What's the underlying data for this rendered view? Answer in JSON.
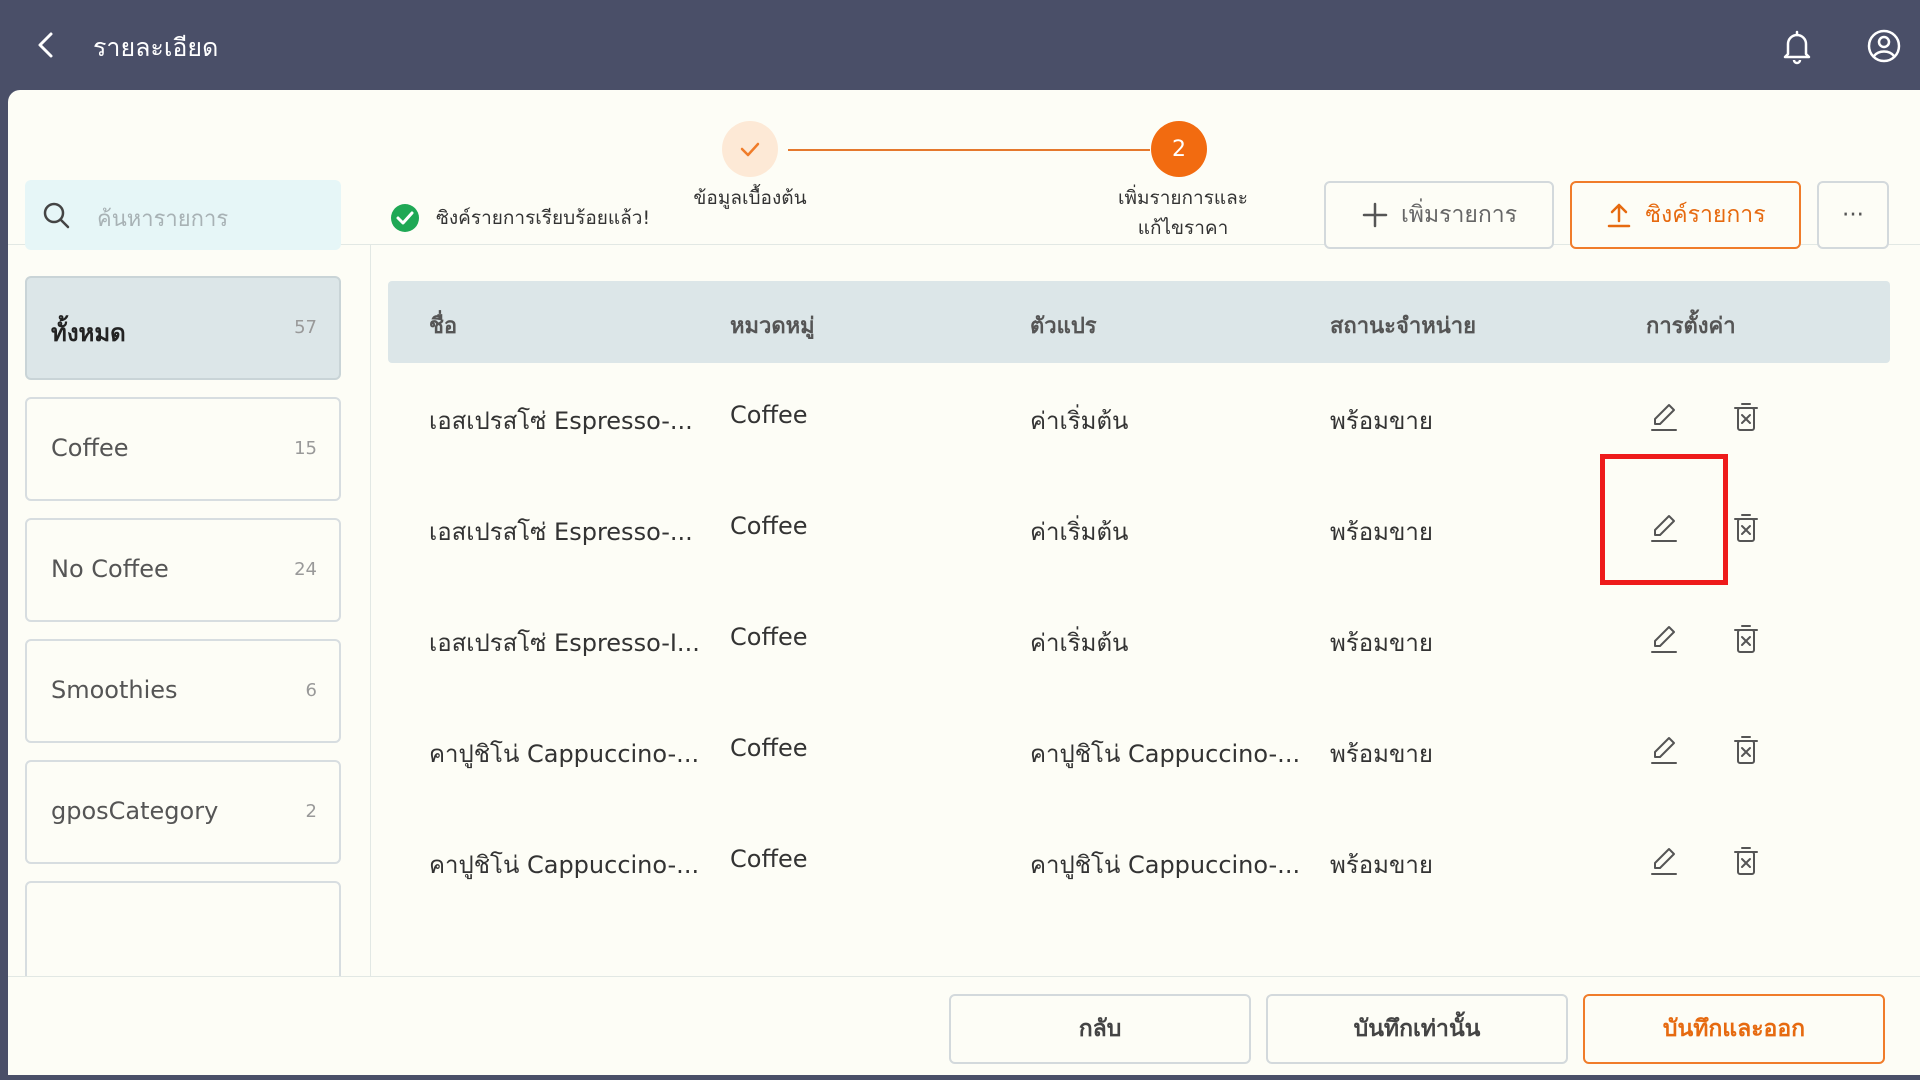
{
  "header": {
    "title": "รายละเอียด"
  },
  "stepper": {
    "step1": {
      "label": "ข้อมูลเบื้องต้น",
      "done": true
    },
    "step2": {
      "number": "2",
      "label": "เพิ่มรายการและ\nแก้ไขราคา",
      "active": true
    }
  },
  "sidebar": {
    "search_placeholder": "ค้นหารายการ",
    "categories": [
      {
        "name": "ทั้งหมด",
        "count": "57",
        "active": true
      },
      {
        "name": "Coffee",
        "count": "15"
      },
      {
        "name": "No Coffee",
        "count": "24"
      },
      {
        "name": "Smoothies",
        "count": "6"
      },
      {
        "name": "gposCategory",
        "count": "2"
      }
    ]
  },
  "status": {
    "message": "ซิงค์รายการเรียบร้อยแล้ว!"
  },
  "toolbar": {
    "add_label": "เพิ่มรายการ",
    "sync_label": "ซิงค์รายการ",
    "more_label": "···"
  },
  "table": {
    "headers": [
      "ชื่อ",
      "หมวดหมู่",
      "ตัวแปร",
      "สถานะจำหน่าย",
      "การตั้งค่า"
    ],
    "rows": [
      {
        "name": "เอสเปรสโซ่ Espresso-...",
        "category": "Coffee",
        "variant": "ค่าเริ่มต้น",
        "status": "พร้อมขาย"
      },
      {
        "name": "เอสเปรสโซ่ Espresso-...",
        "category": "Coffee",
        "variant": "ค่าเริ่มต้น",
        "status": "พร้อมขาย"
      },
      {
        "name": "เอสเปรสโซ่ Espresso-I...",
        "category": "Coffee",
        "variant": "ค่าเริ่มต้น",
        "status": "พร้อมขาย"
      },
      {
        "name": "คาปูชิโน่ Cappuccino-...",
        "category": "Coffee",
        "variant": "คาปูชิโน่ Cappuccino-...",
        "status": "พร้อมขาย"
      },
      {
        "name": "คาปูชิโน่ Cappuccino-...",
        "category": "Coffee",
        "variant": "คาปูชิโน่ Cappuccino-...",
        "status": "พร้อมขาย"
      }
    ]
  },
  "footer": {
    "back_label": "กลับ",
    "save_label": "บันทึกเท่านั้น",
    "save_exit_label": "บันทึกและออก"
  },
  "colors": {
    "header_bg": "#4a4f68",
    "accent": "#f26b10",
    "table_head_bg": "#dce6e8",
    "success": "#1fa855",
    "highlight": "#ee1b1b"
  }
}
